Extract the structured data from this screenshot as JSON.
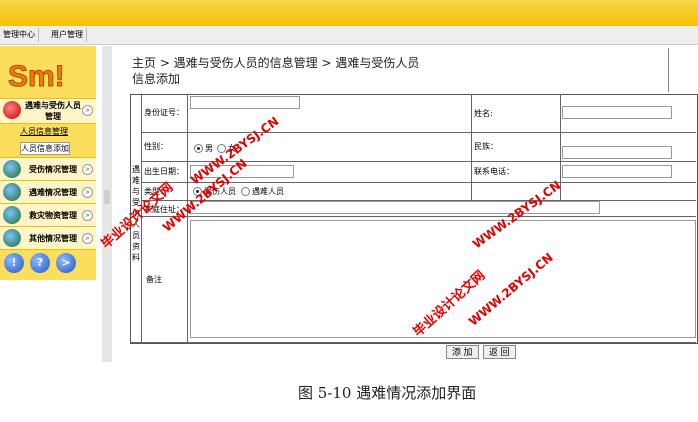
{
  "nav": {
    "tabs": [
      "管理中心",
      "用户管理"
    ]
  },
  "sidebar": {
    "logo": "Sm!",
    "groups": [
      {
        "label": "遇难与受伤人员管理"
      },
      {
        "label": "受伤情况管理"
      },
      {
        "label": "遇难情况管理"
      },
      {
        "label": "救灾物资管理"
      },
      {
        "label": "其他情况管理"
      }
    ],
    "sublinks": [
      "人员信息管理",
      "人员信息添加"
    ],
    "buttons": [
      "!",
      "?",
      ">"
    ]
  },
  "breadcrumb": {
    "line1": "主页 > 遇难与受伤人员的信息管理 > 遇难与受伤人员",
    "line2": "信息添加"
  },
  "form": {
    "section_label": "遇难与受伤人员资料",
    "id_label": "身份证号：",
    "name_label": "姓名:",
    "gender_label": "性别：",
    "gender_male": "男",
    "gender_female": "女",
    "ethnic_label": "民族：",
    "birth_label": "出生日期：",
    "phone_label": "联系电话：",
    "type_label": "类型：",
    "type_injured": "受伤人员",
    "type_victim": "遇难人员",
    "address_label": "家庭住址：",
    "remark_label": "备注"
  },
  "buttons": {
    "add": "添 加",
    "back": "返 回"
  },
  "caption": "图 5-10  遇难情况添加界面",
  "watermark": {
    "line1": "毕业设计论文网",
    "line2": "WWW.2BYSJ.CN"
  },
  "colors": {
    "top_bar": "#f4c400",
    "sidebar": "#fbde5e",
    "watermark": "#e50000"
  }
}
